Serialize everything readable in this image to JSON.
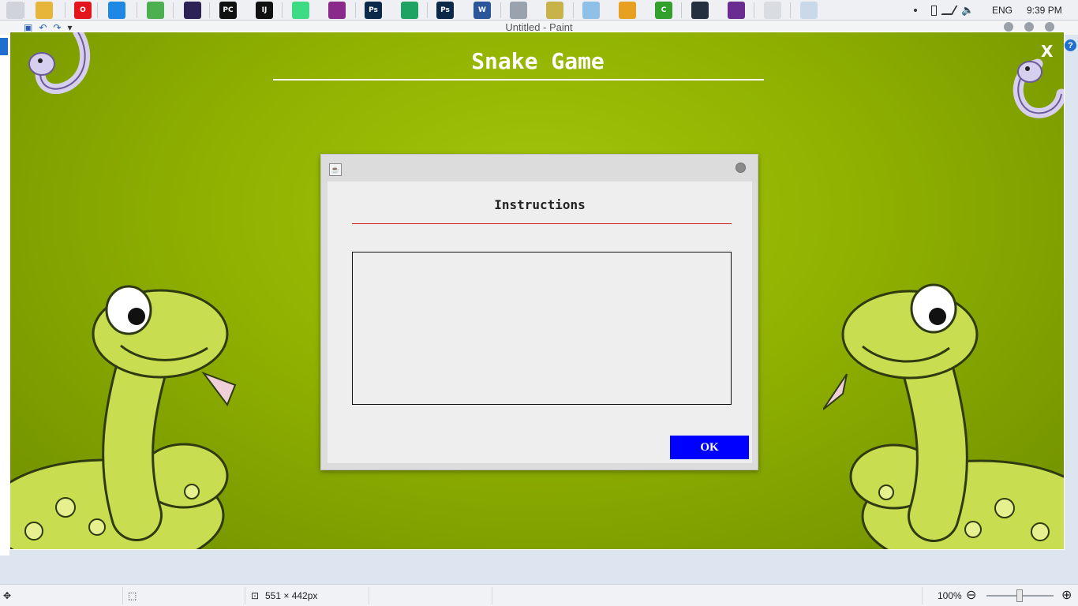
{
  "taskbar": {
    "apps": [
      {
        "name": "start",
        "icon": "windows-icon",
        "color": "#d0d4da",
        "glyph": ""
      },
      {
        "name": "file-explorer",
        "icon": "folder-icon",
        "color": "#e6b53a",
        "glyph": ""
      },
      {
        "name": "opera",
        "icon": "opera-icon",
        "color": "#e4161c",
        "glyph": "O"
      },
      {
        "name": "vscode",
        "icon": "vscode-icon",
        "color": "#1e88e5",
        "glyph": ""
      },
      {
        "name": "chrome",
        "icon": "chrome-icon",
        "color": "#4caf50",
        "glyph": ""
      },
      {
        "name": "eclipse",
        "icon": "eclipse-icon",
        "color": "#2c2255",
        "glyph": ""
      },
      {
        "name": "pycharm",
        "icon": "pycharm-icon",
        "color": "#111111",
        "glyph": "PC"
      },
      {
        "name": "intellij",
        "icon": "intellij-icon",
        "color": "#111111",
        "glyph": "IJ"
      },
      {
        "name": "android-studio",
        "icon": "android-icon",
        "color": "#3ddc84",
        "glyph": ""
      },
      {
        "name": "winrar",
        "icon": "winrar-icon",
        "color": "#8a2a8a",
        "glyph": ""
      },
      {
        "name": "photoshop",
        "icon": "photoshop-icon",
        "color": "#0b2a4a",
        "glyph": "Ps"
      },
      {
        "name": "sheets",
        "icon": "sheets-icon",
        "color": "#1ea362",
        "glyph": ""
      },
      {
        "name": "photoshop-2",
        "icon": "photoshop-icon",
        "color": "#0b2a4a",
        "glyph": "Ps"
      },
      {
        "name": "word",
        "icon": "word-icon",
        "color": "#2b579a",
        "glyph": "W"
      },
      {
        "name": "remote",
        "icon": "window-icon",
        "color": "#9aa3ad",
        "glyph": ""
      },
      {
        "name": "notepad",
        "icon": "notepad-icon",
        "color": "#c7b34a",
        "glyph": ""
      },
      {
        "name": "paint-3d",
        "icon": "paint-icon",
        "color": "#8fc0e8",
        "glyph": ""
      },
      {
        "name": "tool",
        "icon": "tool-icon",
        "color": "#e8a020",
        "glyph": ""
      },
      {
        "name": "camtasia",
        "icon": "camtasia-icon",
        "color": "#33a02c",
        "glyph": "C"
      },
      {
        "name": "media",
        "icon": "media-icon",
        "color": "#243040",
        "glyph": ""
      },
      {
        "name": "github",
        "icon": "github-icon",
        "color": "#6a2c91",
        "glyph": ""
      },
      {
        "name": "java",
        "icon": "java-icon",
        "color": "#d9dde2",
        "glyph": ""
      },
      {
        "name": "paint",
        "icon": "paint-icon",
        "color": "#c9d9ea",
        "glyph": ""
      }
    ],
    "language": "ENG",
    "clock": "9:39 PM"
  },
  "paint": {
    "title": "Untitled - Paint",
    "status": {
      "dimensions": "551 × 442px",
      "zoom": "100%"
    }
  },
  "game": {
    "title": "Snake Game",
    "close_label": "X"
  },
  "dialog": {
    "heading": "Instructions",
    "instructions_text": "",
    "ok_label": "OK"
  },
  "colors": {
    "game_bg": "#8fb000",
    "ok_button": "#0000ff",
    "rule_red": "#d41f1f"
  }
}
